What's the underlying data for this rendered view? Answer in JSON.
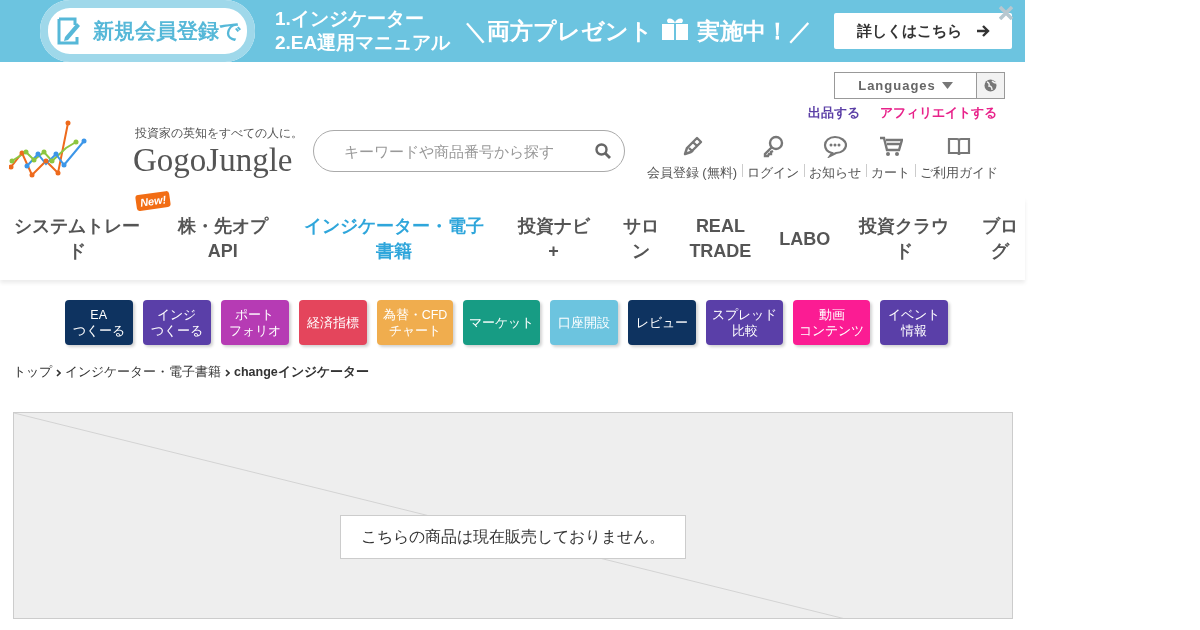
{
  "banner": {
    "lead": "新規会員登録で",
    "items": [
      "1.インジケーター",
      "2.EA運用マニュアル"
    ],
    "offer": "＼両方プレゼント",
    "status": "実施中！／",
    "button": "詳しくはこちら"
  },
  "header": {
    "languages": "Languages",
    "links": [
      {
        "label": "出品する",
        "color": "#5b3fa6"
      },
      {
        "label": "アフィリエイトする",
        "color": "#e8228a"
      }
    ],
    "tagline": "投資家の英知をすべての人に。",
    "logo": "GogoJungle",
    "search": {
      "placeholder": "キーワードや商品番号から探す"
    },
    "icons": [
      {
        "kind": "pencil",
        "label": "会員登録 (無料)"
      },
      {
        "kind": "key",
        "label": "ログイン"
      },
      {
        "kind": "chat",
        "label": "お知らせ"
      },
      {
        "kind": "cart",
        "label": "カート"
      },
      {
        "kind": "book",
        "label": "ご利用ガイド"
      }
    ]
  },
  "nav": [
    {
      "label": "システムトレード",
      "selected": false,
      "badge": "New!"
    },
    {
      "label": "株・先オプAPI",
      "selected": false
    },
    {
      "label": "インジケーター・電子書籍",
      "selected": true
    },
    {
      "label": "投資ナビ+",
      "selected": false
    },
    {
      "label": "サロン",
      "selected": false
    },
    {
      "label": "REAL TRADE",
      "selected": false
    },
    {
      "label": "LABO",
      "selected": false
    },
    {
      "label": "投資クラウド",
      "selected": false
    },
    {
      "label": "ブログ",
      "selected": false
    }
  ],
  "categories": [
    {
      "lines": [
        "EA",
        "つくーる"
      ],
      "color": "#0e3360"
    },
    {
      "lines": [
        "インジ",
        "つくーる"
      ],
      "color": "#5a3fa8"
    },
    {
      "lines": [
        "ポート",
        "フォリオ"
      ],
      "color": "#b63bb4"
    },
    {
      "lines": [
        "経済指標"
      ],
      "color": "#e4455c"
    },
    {
      "lines": [
        "為替・CFD",
        "チャート"
      ],
      "color": "#f0ad4e"
    },
    {
      "lines": [
        "マーケット"
      ],
      "color": "#179c84"
    },
    {
      "lines": [
        "口座開設"
      ],
      "color": "#6cc4df"
    },
    {
      "lines": [
        "レビュー"
      ],
      "color": "#0e3360"
    },
    {
      "lines": [
        "スプレッド",
        "比較"
      ],
      "color": "#5a3fa8"
    },
    {
      "lines": [
        "動画",
        "コンテンツ"
      ],
      "color": "#fb1c93"
    },
    {
      "lines": [
        "イベント",
        "情報"
      ],
      "color": "#5a3fa8"
    }
  ],
  "breadcrumb": [
    "トップ",
    "インジケーター・電子書籍",
    "changeインジケーター"
  ],
  "notice": "こちらの商品は現在販売しておりません。"
}
